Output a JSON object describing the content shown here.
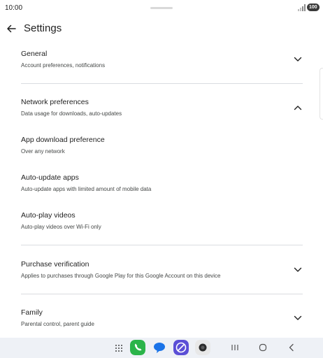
{
  "status": {
    "time": "10:00",
    "battery": "100"
  },
  "header": {
    "title": "Settings"
  },
  "sections": [
    {
      "title": "General",
      "subtitle": "Account preferences, notifications",
      "expanded": false
    },
    {
      "title": "Network preferences",
      "subtitle": "Data usage for downloads, auto-updates",
      "expanded": true
    },
    {
      "title": "Purchase verification",
      "subtitle": "Applies to purchases through Google Play for this Google Account on this device",
      "expanded": false
    },
    {
      "title": "Family",
      "subtitle": "Parental control, parent guide",
      "expanded": false
    }
  ],
  "network_items": [
    {
      "title": "App download preference",
      "subtitle": "Over any network"
    },
    {
      "title": "Auto-update apps",
      "subtitle": "Auto-update apps with limited amount of mobile data"
    },
    {
      "title": "Auto-play videos",
      "subtitle": "Auto-play videos over Wi-Fi only"
    }
  ],
  "colors": {
    "phone_app": "#2bb44a",
    "messages_app": "#1a73e8",
    "internet_app": "#5b4fd6",
    "camera_app": "#e8e8e8",
    "nav_background": "#eef1f6"
  },
  "nav": {
    "apps": [
      "app-drawer-icon",
      "phone-icon",
      "messages-icon",
      "internet-icon",
      "camera-icon"
    ],
    "buttons": [
      "recents-icon",
      "home-icon",
      "back-icon"
    ]
  }
}
